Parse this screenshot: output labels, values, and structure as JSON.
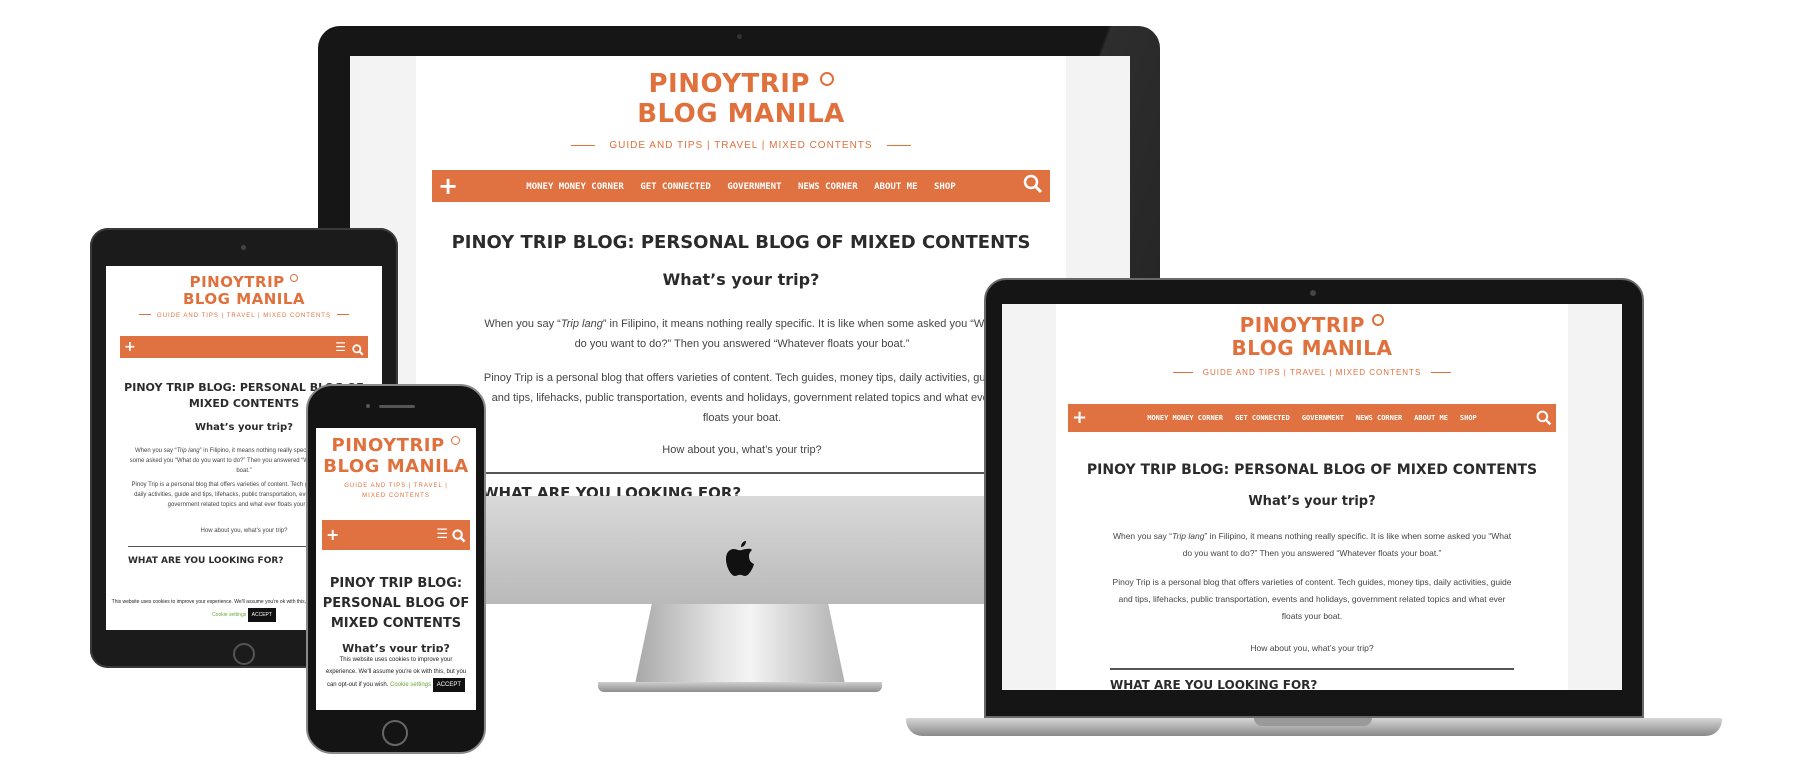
{
  "site": {
    "logo_line1": "PINOYTRIP",
    "logo_line2": "BLOG MANILA",
    "tagline": "GUIDE AND TIPS | TRAVEL | MIXED CONTENTS",
    "nav_items": [
      "MONEY MONEY CORNER",
      "GET CONNECTED",
      "GOVERNMENT",
      "NEWS CORNER",
      "ABOUT ME",
      "SHOP"
    ],
    "plus_icon": "+",
    "search_icon": "⚲",
    "menu_icon": "☰",
    "title": "PINOY TRIP BLOG: PERSONAL BLOG OF MIXED CONTENTS",
    "title_line1": "PINOY TRIP BLOG:",
    "title_line2": "PERSONAL BLOG OF",
    "title_line3": "MIXED CONTENTS",
    "tablet_title_line1": "PINOY TRIP BLOG: PERSONAL BLOG OF",
    "tablet_title_line2": "MIXED CONTENTS",
    "subtitle": "What’s your trip?",
    "para1_a": "When you say “",
    "para1_em": "Trip lang",
    "para1_b": "” in Filipino, it means nothing really specific. It is like when some asked you “What do you want to do?” Then you answered “Whatever floats your boat.”",
    "para2": "Pinoy Trip is a personal blog that offers varieties of content. Tech guides, money tips, daily activities, guide and tips, lifehacks, public transportation, events and holidays, government related topics and what ever floats your boat.",
    "para3": "How about you, what’s your trip?",
    "section_heading": "WHAT ARE YOU LOOKING FOR?",
    "cookie_text": "This website uses cookies to improve your experience. We'll assume you're ok with this, but you can opt-out if you wish.",
    "cookie_settings": "Cookie settings",
    "cookie_accept": "ACCEPT"
  },
  "colors": {
    "accent": "#e07141",
    "device_black": "#1a1a1a",
    "silver": "#c9c9c9"
  }
}
